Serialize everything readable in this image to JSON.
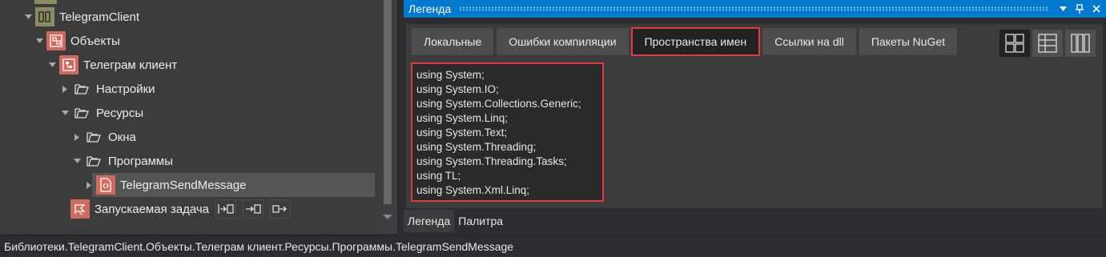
{
  "tree": {
    "items": [
      {
        "label": "TelegramClient"
      },
      {
        "label": "Объекты"
      },
      {
        "label": "Телеграм клиент"
      },
      {
        "label": "Настройки"
      },
      {
        "label": "Ресурсы"
      },
      {
        "label": "Окна"
      },
      {
        "label": "Программы"
      },
      {
        "label": "TelegramSendMessage"
      },
      {
        "label": "Запускаемая задача"
      }
    ]
  },
  "panel": {
    "title": "Легенда",
    "tabs": [
      "Локальные",
      "Ошибки компиляции",
      "Пространства имен",
      "Ссылки на dll",
      "Пакеты NuGet"
    ],
    "active_tab": "Пространства имен",
    "code_lines": [
      "using System;",
      "using System.IO;",
      "using System.Collections.Generic;",
      "using System.Linq;",
      "using System.Text;",
      "using System.Threading;",
      "using System.Threading.Tasks;",
      "using TL;",
      "using System.Xml.Linq;"
    ],
    "bottom_tabs": [
      "Легенда",
      "Палитра"
    ]
  },
  "status": {
    "path": "Библиотеки.TelegramClient.Объекты.Телеграм клиент.Ресурсы.Программы.TelegramSendMessage"
  },
  "colors": {
    "accent": "#007acc",
    "highlight": "#e0393e",
    "icon_red": "#d0695e"
  }
}
